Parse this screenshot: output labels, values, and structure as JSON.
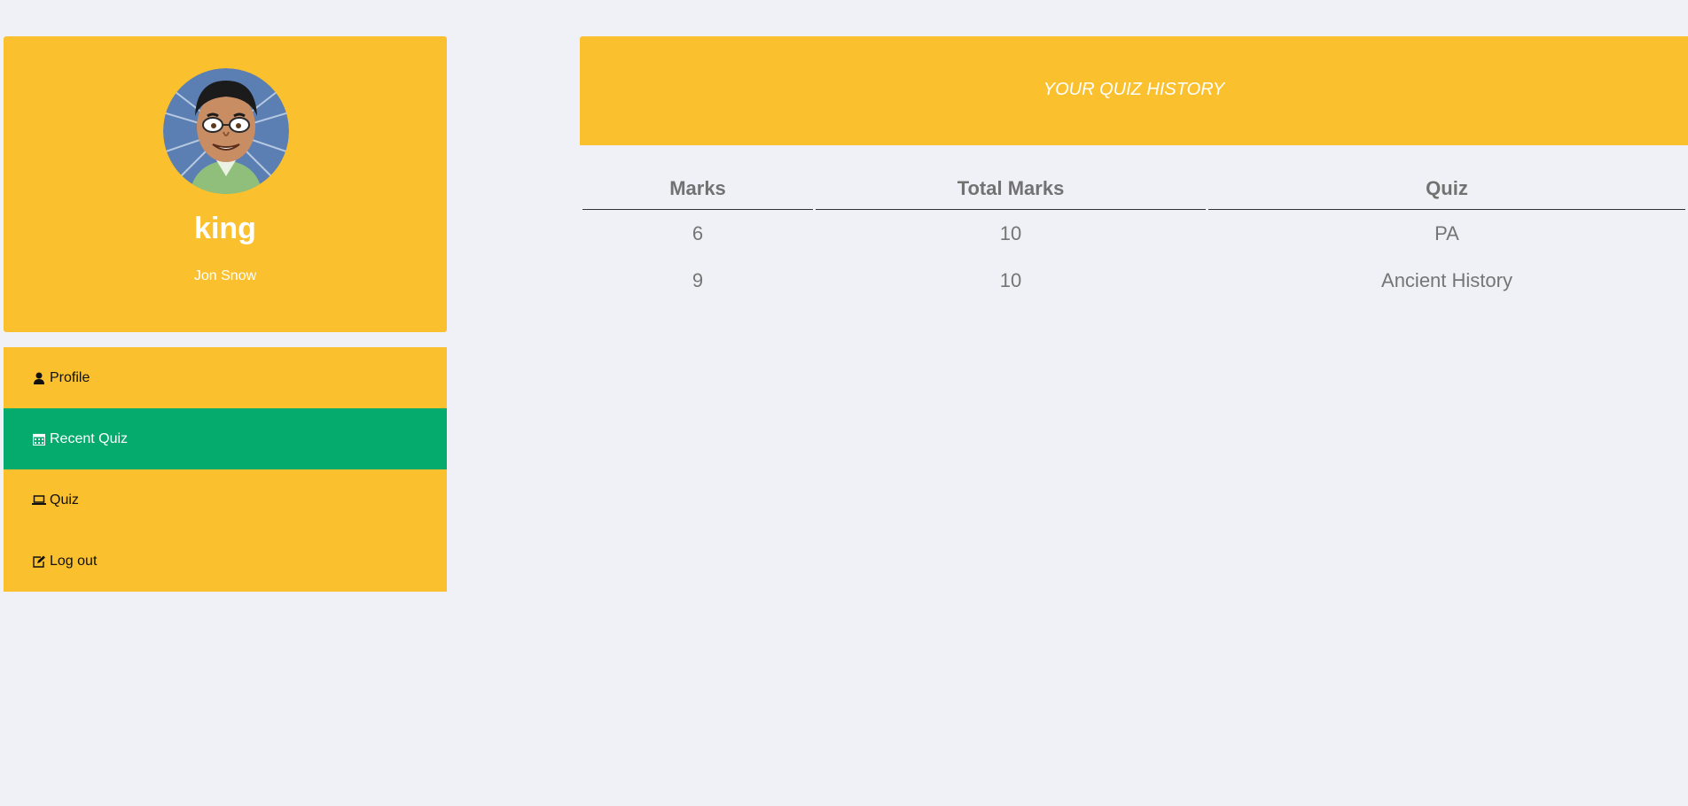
{
  "profile": {
    "username": "king",
    "full_name": "Jon Snow",
    "avatar_icon": "cartoon-avatar-icon"
  },
  "menu": {
    "items": [
      {
        "label": "Profile",
        "icon": "user-icon",
        "active": false
      },
      {
        "label": "Recent Quiz",
        "icon": "calendar-icon",
        "active": true
      },
      {
        "label": "Quiz",
        "icon": "laptop-icon",
        "active": false
      },
      {
        "label": "Log out",
        "icon": "edit-icon",
        "active": false
      }
    ]
  },
  "main": {
    "title": "YOUR QUIZ HISTORY",
    "table": {
      "headers": [
        "Marks",
        "Total Marks",
        "Quiz"
      ],
      "rows": [
        [
          "6",
          "10",
          "PA"
        ],
        [
          "9",
          "10",
          "Ancient History"
        ]
      ]
    }
  },
  "colors": {
    "accent_yellow": "#fbc02d",
    "active_green": "#05aa6d",
    "page_background": "#f0f1f6",
    "table_text": "#757575"
  }
}
